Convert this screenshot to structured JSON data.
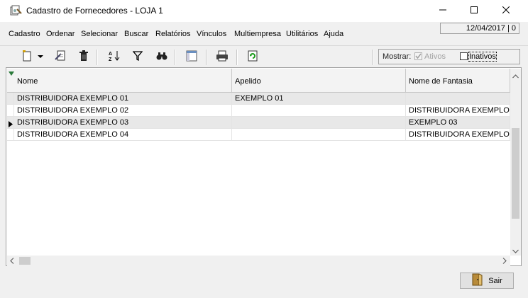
{
  "window": {
    "title": "Cadastro de Fornecedores - LOJA 1",
    "icons": [
      "app-icon",
      "minimize-icon",
      "maximize-icon",
      "close-icon"
    ]
  },
  "menu": {
    "items": [
      {
        "label": "Cadastro"
      },
      {
        "label": "Ordenar"
      },
      {
        "label": "Selecionar"
      },
      {
        "label": "Buscar"
      },
      {
        "label": "Relatórios"
      },
      {
        "label": "Vínculos"
      },
      {
        "label": "Multiempresa"
      },
      {
        "label": "Utilitários"
      },
      {
        "label": "Ajuda"
      }
    ],
    "date_status": "12/04/2017 | 0"
  },
  "toolbar": {
    "icons": [
      "new-record-icon",
      "dropdown-arrow-icon",
      "edit-icon",
      "delete-icon",
      "sort-az-icon",
      "filter-icon",
      "find-icon",
      "columns-icon",
      "print-icon",
      "refresh-icon"
    ]
  },
  "filter": {
    "label": "Mostrar:",
    "ativos": {
      "label": "Ativos",
      "checked": true,
      "enabled": false
    },
    "inativos": {
      "label": "Inativos",
      "checked": false,
      "enabled": true
    }
  },
  "grid": {
    "columns": [
      "Nome",
      "Apelido",
      "Nome de Fantasia"
    ],
    "rows": [
      [
        "DISTRIBUIDORA EXEMPLO 01",
        "EXEMPLO 01",
        ""
      ],
      [
        "DISTRIBUIDORA EXEMPLO 02",
        "",
        "DISTRIBUIDORA EXEMPLO"
      ],
      [
        "DISTRIBUIDORA EXEMPLO 03",
        "",
        "EXEMPLO 03"
      ],
      [
        "DISTRIBUIDORA EXEMPLO 04",
        "",
        "DISTRIBUIDORA EXEMPLO"
      ]
    ],
    "current_row": 2
  },
  "footer": {
    "exit_label": "Sair"
  }
}
